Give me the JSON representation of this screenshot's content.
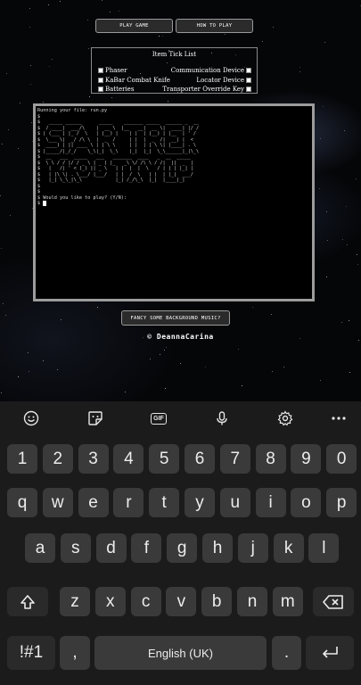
{
  "nav": {
    "play_game": "PLAY GAME",
    "how_to_play": "HOW TO PLAY"
  },
  "ticklist": {
    "title": "Item Tick List",
    "left": [
      "Phaser",
      "KaBar Combat Knife",
      "Batteries"
    ],
    "right": [
      "Communication Device",
      "Locator Device",
      "Transporter Override Key"
    ]
  },
  "terminal": {
    "lines": [
      "Running your file: run.py",
      "",
      "",
      "$",
      "$   _____ ______      _____    _______ _____  ______ _  __",
      "$  / ____|  ___/\\    |  __ \\  |__   __|  __ \\|  ____| |/ /",
      "$ | (___ | |_ /  \\   | |__) |    | |  | |__) | |__  | ' / ",
      "$  \\___ \\|  _/ /\\ \\  |  _  /     | |  |  _  /|  __| |  <  ",
      "$  ____) | || ____ \\ | | \\ \\     | |  | | \\ \\| |____| . \\ ",
      "$ |_____/|_/_/    \\_\\|_|  \\_\\    |_|  |_|  \\_\\______|_|\\_\\",
      "$  __   ___  _____   ___   _______  ____   _  __  _____ ",
      "$  \\ \\ / / |/ / _ \\ | _ ) |_   _\\ \\/ /\\ \\ / /|  ||  _  |",
      "$   |   /| ' < (_) || _ \\   | |  |  |  \\   / | | | |_| |",
      "$   | |\\ \\| . \\___/ |___/   | |  /  \\   | |  | |_|  ___/",
      "$   |_| \\_\\_|\\_\\            |_| /_/\\_\\  |_|  |____|_|   ",
      "$",
      "$",
      "$ Would you like to play? (Y/N):",
      "$ "
    ]
  },
  "music_button": "FANCY SOME BACKGROUND MUSIC?",
  "credit": "© DeannaCarina",
  "keyboard": {
    "toolbar": [
      "emoji-icon",
      "sticker-icon",
      "gif-icon",
      "microphone-icon",
      "settings-icon",
      "more-icon"
    ],
    "gif_label": "GIF",
    "row1": [
      "1",
      "2",
      "3",
      "4",
      "5",
      "6",
      "7",
      "8",
      "9",
      "0"
    ],
    "row2": [
      "q",
      "w",
      "e",
      "r",
      "t",
      "y",
      "u",
      "i",
      "o",
      "p"
    ],
    "row3": [
      "a",
      "s",
      "d",
      "f",
      "g",
      "h",
      "j",
      "k",
      "l"
    ],
    "row4": [
      "z",
      "x",
      "c",
      "v",
      "b",
      "n",
      "m"
    ],
    "symbols": "!#1",
    "comma": ",",
    "space": "English (UK)",
    "period": "."
  }
}
